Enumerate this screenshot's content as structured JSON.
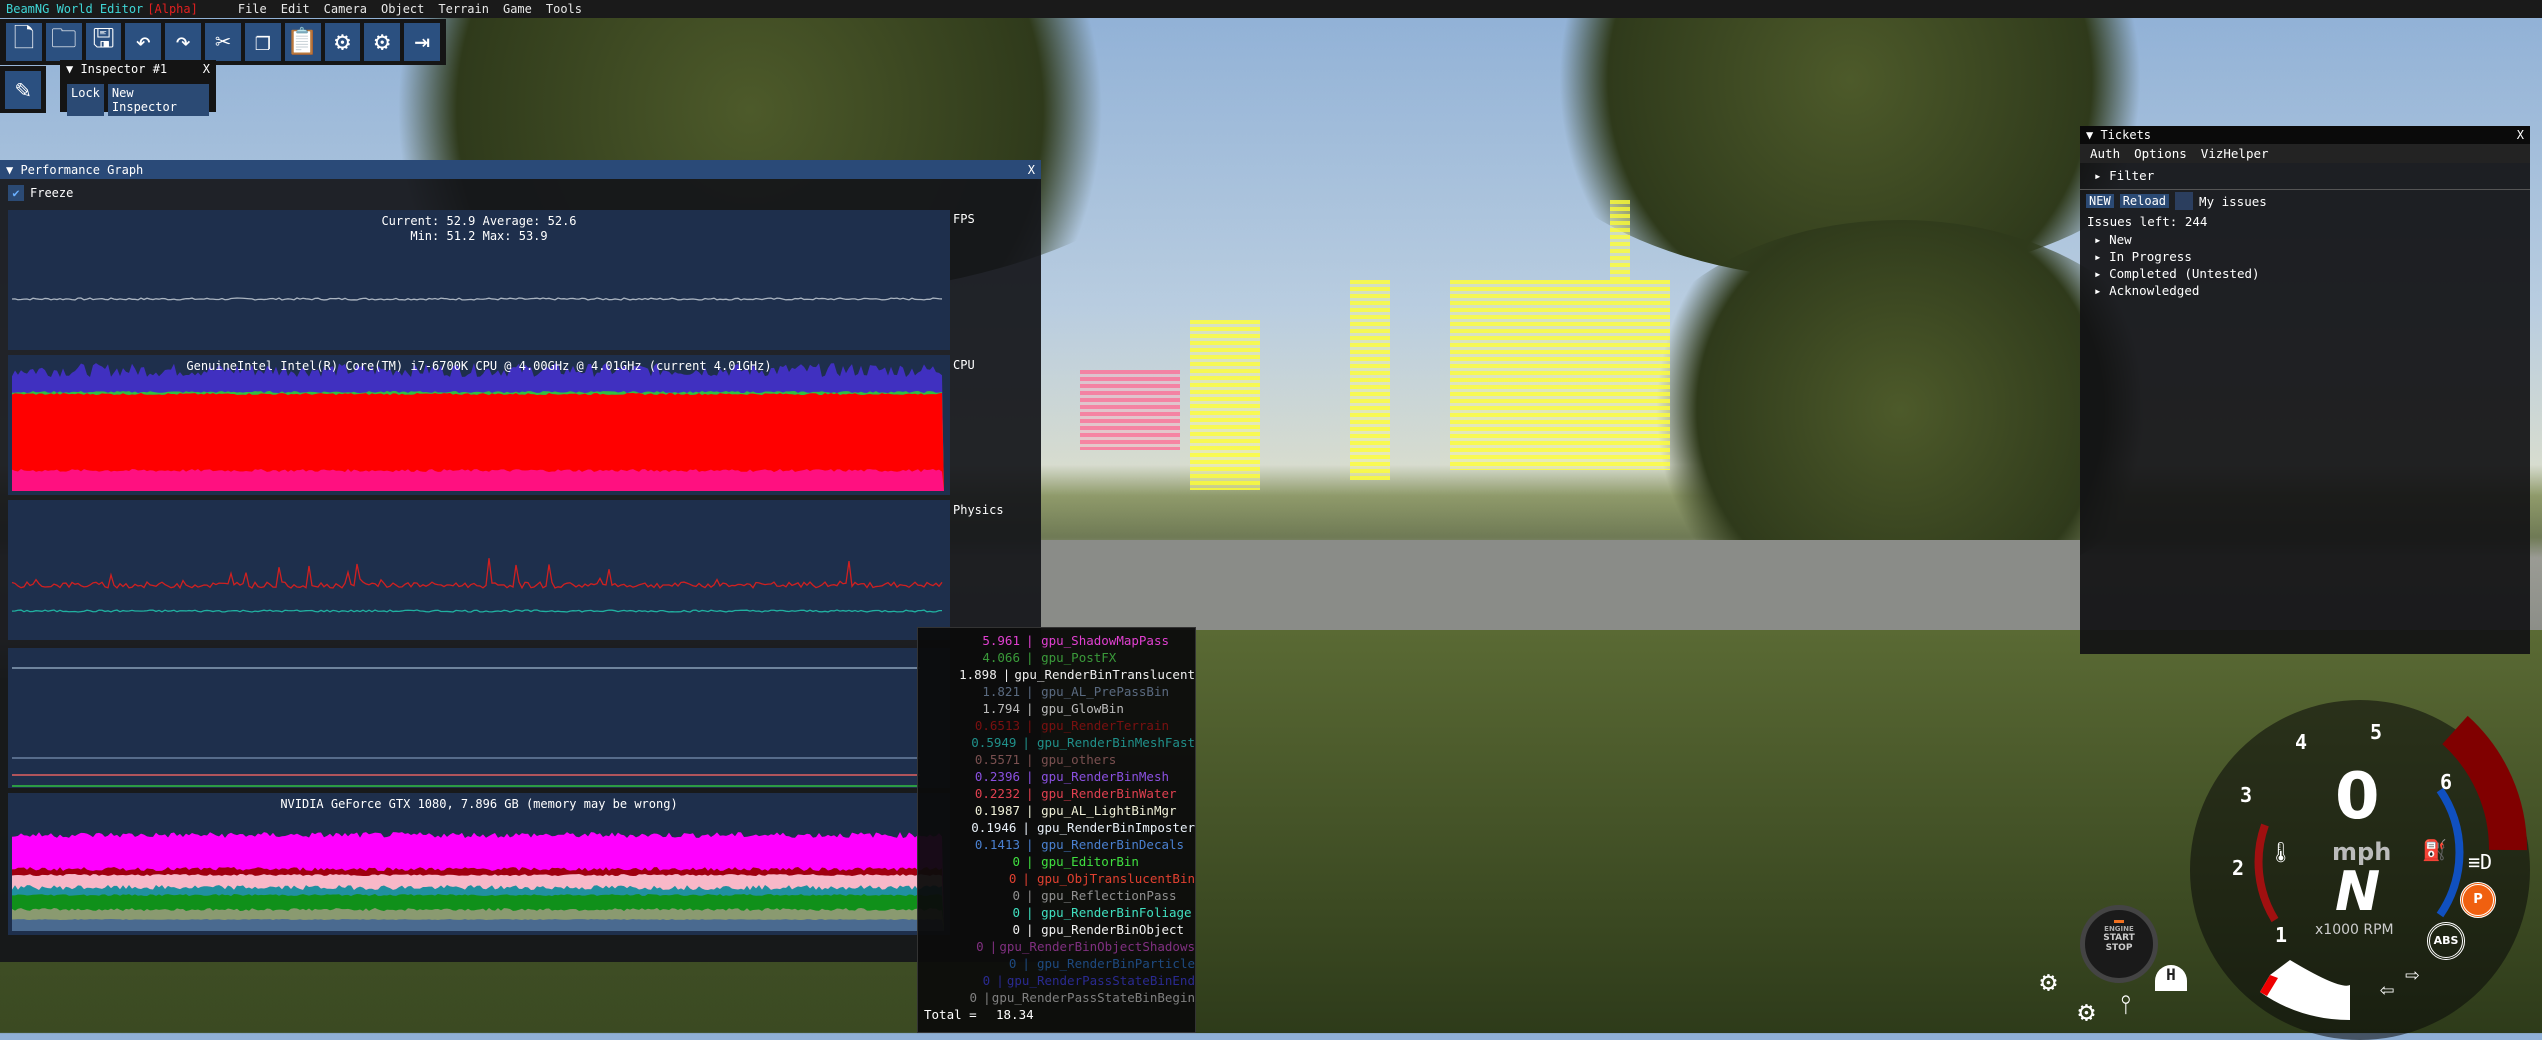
{
  "menubar": {
    "title": "BeamNG World Editor",
    "badge": "[Alpha]",
    "items": [
      "File",
      "Edit",
      "Camera",
      "Object",
      "Terrain",
      "Game",
      "Tools"
    ]
  },
  "toolbar": {
    "icons": [
      "new-file-icon",
      "open-folder-icon",
      "save-icon",
      "undo-icon",
      "redo-icon",
      "cut-icon",
      "copy-icon",
      "paste-icon",
      "settings-gear-icon",
      "preferences-gear-icon",
      "exit-icon"
    ]
  },
  "inspector": {
    "title": "Inspector #1",
    "close": "X",
    "lock": "Lock",
    "new": "New Inspector"
  },
  "perf": {
    "title": "Performance Graph",
    "close": "X",
    "freeze": "Freeze",
    "freeze_checked": true,
    "fps": {
      "label": "FPS",
      "line1": "Current: 52.9   Average: 52.6",
      "line2": "Min: 51.2  Max: 53.9"
    },
    "cpu": {
      "label": "CPU",
      "title": "GenuineIntel Intel(R) Core(TM) i7-6700K CPU @ 4.00GHz @ 4.01GHz (current 4.01GHz)"
    },
    "physics": {
      "label": "Physics"
    },
    "gpu": {
      "title": "NVIDIA GeForce GTX 1080, 7.896 GB (memory may be wrong)"
    }
  },
  "gpulist": {
    "rows": [
      {
        "v": "5.961",
        "n": "gpu_ShadowMapPass",
        "c": "#e040d0"
      },
      {
        "v": "4.066",
        "n": "gpu_PostFX",
        "c": "#3a9a3a"
      },
      {
        "v": "1.898",
        "n": "gpu_RenderBinTranslucent",
        "c": "#f0f0f0"
      },
      {
        "v": "1.821",
        "n": "gpu_AL_PrePassBin",
        "c": "#5a6a80"
      },
      {
        "v": "1.794",
        "n": "gpu_GlowBin",
        "c": "#bcbcbc"
      },
      {
        "v": "0.6513",
        "n": "gpu_RenderTerrain",
        "c": "#7a1010"
      },
      {
        "v": "0.5949",
        "n": "gpu_RenderBinMeshFast",
        "c": "#20908a"
      },
      {
        "v": "0.5571",
        "n": "gpu_others",
        "c": "#7a5050"
      },
      {
        "v": "0.2396",
        "n": "gpu_RenderBinMesh",
        "c": "#8a50e0"
      },
      {
        "v": "0.2232",
        "n": "gpu_RenderBinWater",
        "c": "#e04050"
      },
      {
        "v": "0.1987",
        "n": "gpu_AL_LightBinMgr",
        "c": "#f0f0d8"
      },
      {
        "v": "0.1946",
        "n": "gpu_RenderBinImposter",
        "c": "#e8f0f8"
      },
      {
        "v": "0.1413",
        "n": "gpu_RenderBinDecals",
        "c": "#4a80d0"
      },
      {
        "v": "0",
        "n": "gpu_EditorBin",
        "c": "#40e040"
      },
      {
        "v": "0",
        "n": "gpu_ObjTranslucentBin",
        "c": "#e04030"
      },
      {
        "v": "0",
        "n": "gpu_ReflectionPass",
        "c": "#909090"
      },
      {
        "v": "0",
        "n": "gpu_RenderBinFoliage",
        "c": "#40e0c0"
      },
      {
        "v": "0",
        "n": "gpu_RenderBinObject",
        "c": "#f0f0f0"
      },
      {
        "v": "0",
        "n": "gpu_RenderBinObjectShadows",
        "c": "#803080"
      },
      {
        "v": "0",
        "n": "gpu_RenderBinParticle",
        "c": "#1e4a80"
      },
      {
        "v": "0",
        "n": "gpu_RenderPassStateBinEnd",
        "c": "#2a2a90"
      },
      {
        "v": "0",
        "n": "gpu_RenderPassStateBinBegin",
        "c": "#808080"
      }
    ],
    "total_label": "Total =",
    "total": "18.34"
  },
  "tickets": {
    "title": "Tickets",
    "close": "X",
    "menu": [
      "Auth",
      "Options",
      "VizHelper"
    ],
    "filter": "Filter",
    "new": "NEW",
    "reload": "Reload",
    "my_issues": "My issues",
    "issues_left": "Issues left: 244",
    "groups": [
      "New",
      "In Progress",
      "Completed (Untested)",
      "Acknowledged"
    ]
  },
  "dash": {
    "speed": "0",
    "unit": "mph",
    "gear": "N",
    "rpm_label": "x1000 RPM",
    "ticks": [
      "1",
      "2",
      "3",
      "4",
      "5",
      "6"
    ],
    "engine": "ENGINE",
    "start": "START",
    "stop": "STOP",
    "abs": "ABS",
    "park": "P",
    "diff": "H"
  }
}
